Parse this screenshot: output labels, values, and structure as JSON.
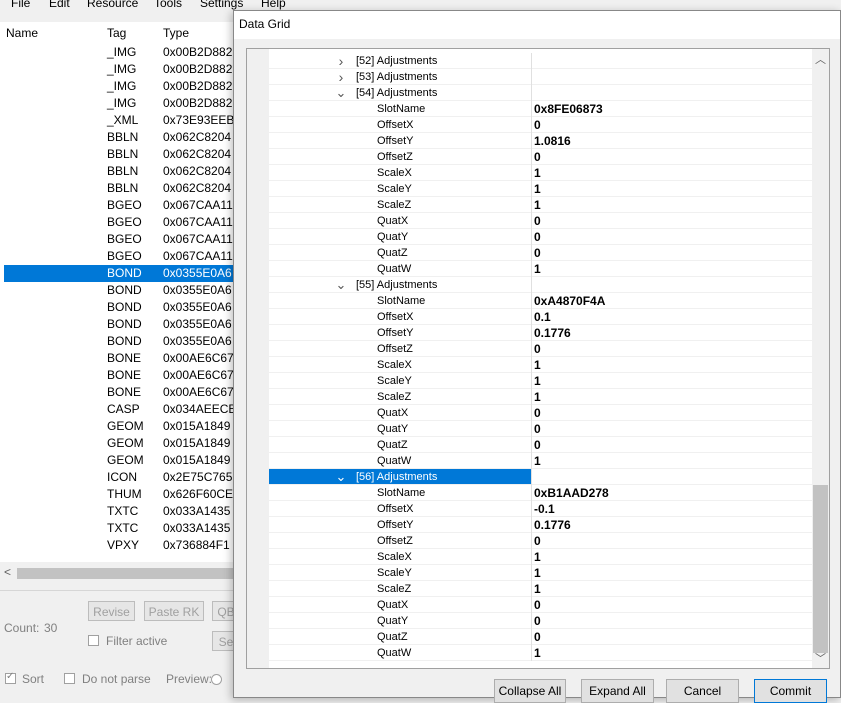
{
  "menu": [
    "File",
    "Edit",
    "Resource",
    "Tools",
    "Settings",
    "Help"
  ],
  "list": {
    "headers": {
      "name": "Name",
      "tag": "Tag",
      "type": "Type"
    },
    "rows": [
      {
        "tag": "_IMG",
        "type": "0x00B2D882"
      },
      {
        "tag": "_IMG",
        "type": "0x00B2D882"
      },
      {
        "tag": "_IMG",
        "type": "0x00B2D882"
      },
      {
        "tag": "_IMG",
        "type": "0x00B2D882"
      },
      {
        "tag": "_XML",
        "type": "0x73E93EEB"
      },
      {
        "tag": "BBLN",
        "type": "0x062C8204"
      },
      {
        "tag": "BBLN",
        "type": "0x062C8204"
      },
      {
        "tag": "BBLN",
        "type": "0x062C8204"
      },
      {
        "tag": "BBLN",
        "type": "0x062C8204"
      },
      {
        "tag": "BGEO",
        "type": "0x067CAA11"
      },
      {
        "tag": "BGEO",
        "type": "0x067CAA11"
      },
      {
        "tag": "BGEO",
        "type": "0x067CAA11"
      },
      {
        "tag": "BGEO",
        "type": "0x067CAA11"
      },
      {
        "tag": "BOND",
        "type": "0x0355E0A6",
        "selected": true
      },
      {
        "tag": "BOND",
        "type": "0x0355E0A6"
      },
      {
        "tag": "BOND",
        "type": "0x0355E0A6"
      },
      {
        "tag": "BOND",
        "type": "0x0355E0A6"
      },
      {
        "tag": "BOND",
        "type": "0x0355E0A6"
      },
      {
        "tag": "BONE",
        "type": "0x00AE6C67"
      },
      {
        "tag": "BONE",
        "type": "0x00AE6C67"
      },
      {
        "tag": "BONE",
        "type": "0x00AE6C67"
      },
      {
        "tag": "CASP",
        "type": "0x034AEECB"
      },
      {
        "tag": "GEOM",
        "type": "0x015A1849"
      },
      {
        "tag": "GEOM",
        "type": "0x015A1849"
      },
      {
        "tag": "GEOM",
        "type": "0x015A1849"
      },
      {
        "tag": "ICON",
        "type": "0x2E75C765"
      },
      {
        "tag": "THUM",
        "type": "0x626F60CE"
      },
      {
        "tag": "TXTC",
        "type": "0x033A1435"
      },
      {
        "tag": "TXTC",
        "type": "0x033A1435"
      },
      {
        "tag": "VPXY",
        "type": "0x736884F1"
      }
    ]
  },
  "bottom": {
    "count_label": "Count:",
    "count_value": "30",
    "revise": "Revise",
    "paste_rk": "Paste RK",
    "qb": "QB",
    "se": "Se",
    "filter_active": "Filter active",
    "sort": "Sort",
    "do_not_parse": "Do not parse",
    "preview": "Preview:"
  },
  "dialog": {
    "title": "Data Grid",
    "rows": [
      {
        "kind": "group",
        "label": "[52] Adjustments",
        "expanded": false
      },
      {
        "kind": "group",
        "label": "[53] Adjustments",
        "expanded": false
      },
      {
        "kind": "group",
        "label": "[54] Adjustments",
        "expanded": true
      },
      {
        "kind": "field",
        "label": "SlotName",
        "value": "0x8FE06873"
      },
      {
        "kind": "field",
        "label": "OffsetX",
        "value": "0"
      },
      {
        "kind": "field",
        "label": "OffsetY",
        "value": "1.0816"
      },
      {
        "kind": "field",
        "label": "OffsetZ",
        "value": "0"
      },
      {
        "kind": "field",
        "label": "ScaleX",
        "value": "1"
      },
      {
        "kind": "field",
        "label": "ScaleY",
        "value": "1"
      },
      {
        "kind": "field",
        "label": "ScaleZ",
        "value": "1"
      },
      {
        "kind": "field",
        "label": "QuatX",
        "value": "0"
      },
      {
        "kind": "field",
        "label": "QuatY",
        "value": "0"
      },
      {
        "kind": "field",
        "label": "QuatZ",
        "value": "0"
      },
      {
        "kind": "field",
        "label": "QuatW",
        "value": "1"
      },
      {
        "kind": "group",
        "label": "[55] Adjustments",
        "expanded": true
      },
      {
        "kind": "field",
        "label": "SlotName",
        "value": "0xA4870F4A"
      },
      {
        "kind": "field",
        "label": "OffsetX",
        "value": "0.1"
      },
      {
        "kind": "field",
        "label": "OffsetY",
        "value": "0.1776"
      },
      {
        "kind": "field",
        "label": "OffsetZ",
        "value": "0"
      },
      {
        "kind": "field",
        "label": "ScaleX",
        "value": "1"
      },
      {
        "kind": "field",
        "label": "ScaleY",
        "value": "1"
      },
      {
        "kind": "field",
        "label": "ScaleZ",
        "value": "1"
      },
      {
        "kind": "field",
        "label": "QuatX",
        "value": "0"
      },
      {
        "kind": "field",
        "label": "QuatY",
        "value": "0"
      },
      {
        "kind": "field",
        "label": "QuatZ",
        "value": "0"
      },
      {
        "kind": "field",
        "label": "QuatW",
        "value": "1"
      },
      {
        "kind": "group",
        "label": "[56] Adjustments",
        "expanded": true,
        "selected": true
      },
      {
        "kind": "field",
        "label": "SlotName",
        "value": "0xB1AAD278"
      },
      {
        "kind": "field",
        "label": "OffsetX",
        "value": "-0.1"
      },
      {
        "kind": "field",
        "label": "OffsetY",
        "value": "0.1776"
      },
      {
        "kind": "field",
        "label": "OffsetZ",
        "value": "0"
      },
      {
        "kind": "field",
        "label": "ScaleX",
        "value": "1"
      },
      {
        "kind": "field",
        "label": "ScaleY",
        "value": "1"
      },
      {
        "kind": "field",
        "label": "ScaleZ",
        "value": "1"
      },
      {
        "kind": "field",
        "label": "QuatX",
        "value": "0"
      },
      {
        "kind": "field",
        "label": "QuatY",
        "value": "0"
      },
      {
        "kind": "field",
        "label": "QuatZ",
        "value": "0"
      },
      {
        "kind": "field",
        "label": "QuatW",
        "value": "1"
      }
    ],
    "buttons": {
      "collapse_all": "Collapse All",
      "expand_all": "Expand All",
      "cancel": "Cancel",
      "commit": "Commit"
    }
  },
  "icons": {
    "group_collapsed": "chevron-right-icon",
    "group_expanded": "chevron-down-icon",
    "scroll_up": "arrow-up-icon",
    "scroll_down": "arrow-down-icon",
    "scroll_left": "arrow-left-icon"
  },
  "colors": {
    "selection": "#0078d7",
    "window_bg": "#f0f0f0",
    "grid_bg": "#ffffff"
  }
}
